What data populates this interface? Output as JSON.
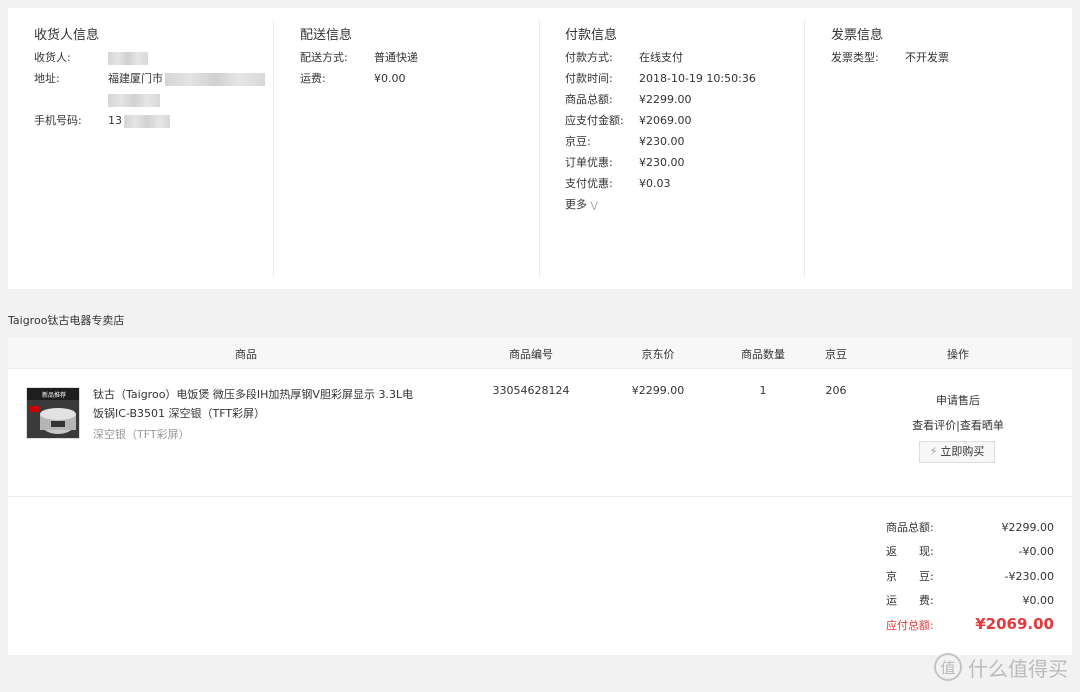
{
  "consignee": {
    "title": "收货人信息",
    "receiver_label": "收货人:",
    "address_label": "地址:",
    "address_value": "福建厦门市",
    "phone_label": "手机号码:",
    "phone_value": "13"
  },
  "delivery": {
    "title": "配送信息",
    "method_label": "配送方式:",
    "method_value": "普通快递",
    "fee_label": "运费:",
    "fee_value": "¥0.00"
  },
  "payment": {
    "title": "付款信息",
    "rows": [
      {
        "label": "付款方式:",
        "value": "在线支付"
      },
      {
        "label": "付款时间:",
        "value": "2018-10-19 10:50:36"
      },
      {
        "label": "商品总额:",
        "value": "¥2299.00"
      },
      {
        "label": "应支付金额:",
        "value": "¥2069.00"
      },
      {
        "label": "京豆:",
        "value": "¥230.00"
      },
      {
        "label": "订单优惠:",
        "value": "¥230.00"
      },
      {
        "label": "支付优惠:",
        "value": "¥0.03"
      }
    ],
    "more_label": "更多"
  },
  "invoice": {
    "title": "发票信息",
    "type_label": "发票类型:",
    "type_value": "不开发票"
  },
  "shop": {
    "name": "Taigroo钛古电器专卖店"
  },
  "table": {
    "headers": [
      "商品",
      "商品编号",
      "京东价",
      "商品数量",
      "京豆",
      "操作"
    ]
  },
  "product": {
    "title": "钛古（Taigroo）电饭煲 微压多段IH加热厚钢V胆彩屏显示 3.3L电饭锅IC-B3501 深空银（TFT彩屏）",
    "spec": "深空银（TFT彩屏）",
    "sku": "33054628124",
    "price": "¥2299.00",
    "quantity": "1",
    "beans": "206",
    "image_label": "新品推荐"
  },
  "actions": {
    "after_sale": "申请售后",
    "view_review": "查看评价",
    "separator": "|",
    "view_show": "查看晒单",
    "buy_now": "立即购买"
  },
  "summary": {
    "rows": [
      {
        "label": "商品总额:",
        "value": "¥2299.00"
      },
      {
        "label": "返　　现:",
        "value": "-¥0.00"
      },
      {
        "label": "京　　豆:",
        "value": "-¥230.00"
      },
      {
        "label": "运　　费:",
        "value": "¥0.00"
      }
    ],
    "total_label": "应付总额:",
    "total_value": "¥2069.00"
  },
  "watermark": {
    "logo": "值",
    "text": "什么值得买"
  },
  "colors": {
    "accent_red": "#e4393c",
    "panel_bg": "#ffffff",
    "page_bg": "#f2f2f2"
  }
}
